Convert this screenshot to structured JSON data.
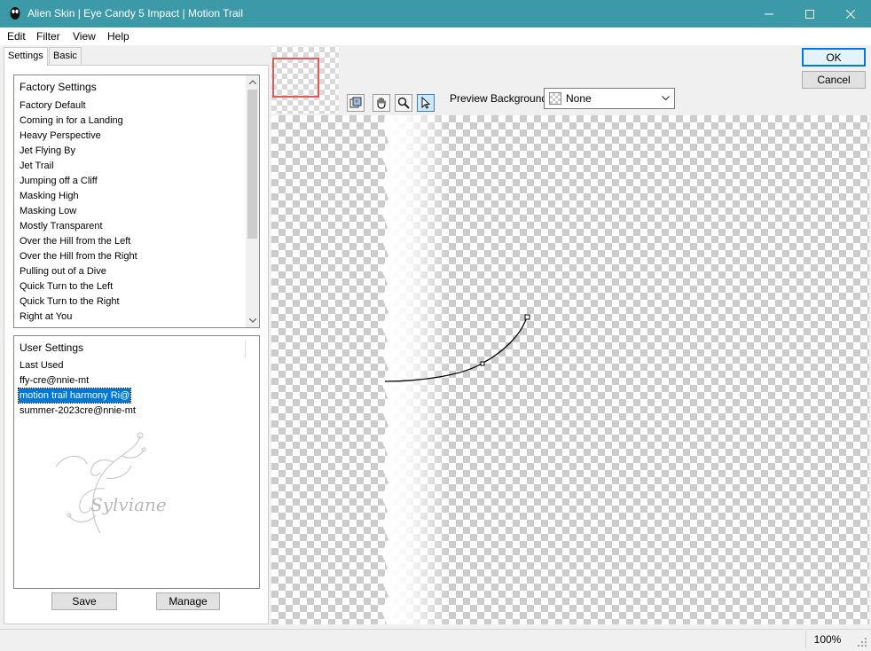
{
  "window": {
    "title": "Alien Skin | Eye Candy 5 Impact | Motion Trail"
  },
  "menu": [
    "Edit",
    "Filter",
    "View",
    "Help"
  ],
  "tabs": [
    "Settings",
    "Basic"
  ],
  "factory": {
    "header": "Factory Settings",
    "items": [
      "Factory Default",
      "Coming in for a Landing",
      "Heavy Perspective",
      "Jet Flying By",
      "Jet Trail",
      "Jumping off a Cliff",
      "Masking High",
      "Masking Low",
      "Mostly Transparent",
      "Over the Hill from the Left",
      "Over the Hill from the Right",
      "Pulling out of a Dive",
      "Quick Turn to the Left",
      "Quick Turn to the Right",
      "Right at You"
    ]
  },
  "user": {
    "header": "User Settings",
    "items": [
      "Last Used",
      "ffy-cre@nnie-mt",
      "motion trail harmony Ri@",
      "summer-2023cre@nnie-mt"
    ],
    "selected_index": 2,
    "watermark": "Sylviane"
  },
  "buttons": {
    "save": "Save",
    "manage": "Manage",
    "ok": "OK",
    "cancel": "Cancel"
  },
  "preview_bg": {
    "label": "Preview Background:",
    "value": "None"
  },
  "status": {
    "zoom": "100%"
  },
  "colors": {
    "titlebar": "#3c9aa8",
    "selection": "#0078d7",
    "navigator_frame": "#e05a5a"
  },
  "icons": [
    "app-icon",
    "minimize-icon",
    "maximize-icon",
    "close-icon",
    "navigator-icon",
    "hand-icon",
    "zoom-icon",
    "pointer-icon",
    "chevron-down-icon"
  ]
}
